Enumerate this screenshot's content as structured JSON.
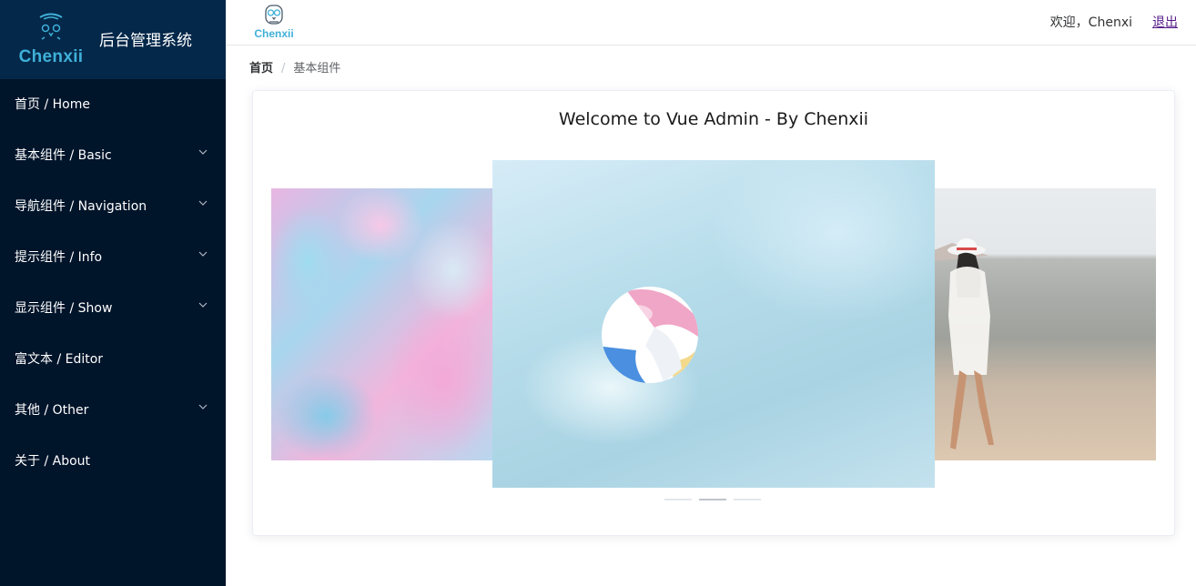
{
  "brand": {
    "logo_text": "Chenxii",
    "title": "后台管理系统"
  },
  "sidebar": {
    "items": [
      {
        "label": "首页 / Home",
        "has_submenu": false
      },
      {
        "label": "基本组件 / Basic",
        "has_submenu": true
      },
      {
        "label": "导航组件 / Navigation",
        "has_submenu": true
      },
      {
        "label": "提示组件 / Info",
        "has_submenu": true
      },
      {
        "label": "显示组件 / Show",
        "has_submenu": true
      },
      {
        "label": "富文本 / Editor",
        "has_submenu": false
      },
      {
        "label": "其他 / Other",
        "has_submenu": true
      },
      {
        "label": "关于 / About",
        "has_submenu": false
      }
    ]
  },
  "header": {
    "logo_text": "Chenxii",
    "welcome": "欢迎，Chenxi",
    "logout": "退出"
  },
  "breadcrumb": {
    "home": "首页",
    "separator": "/",
    "current": "基本组件"
  },
  "main": {
    "title": "Welcome to Vue Admin - By Chenxii",
    "carousel": {
      "slides": [
        "marble-paint-image",
        "beach-ball-water-image",
        "woman-on-beach-image"
      ],
      "active_index": 1
    }
  },
  "colors": {
    "sidebar_bg": "#00142a",
    "brand_bg": "#04284a",
    "accent": "#3fb0d8"
  }
}
